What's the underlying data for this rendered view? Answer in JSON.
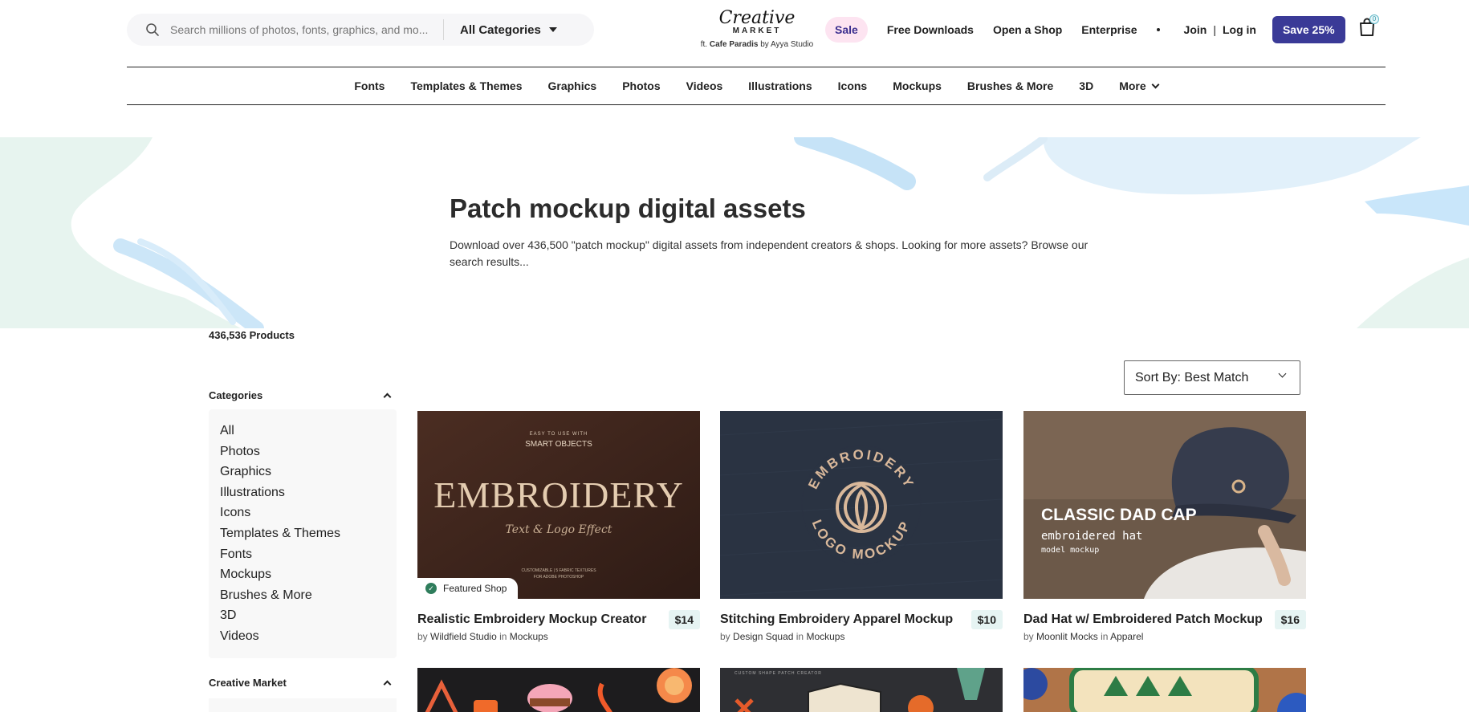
{
  "header": {
    "search_placeholder": "Search millions of photos, fonts, graphics, and mo...",
    "category_select": "All Categories",
    "logo_top": "Creative",
    "logo_bottom": "MARKET",
    "logo_featuring_prefix": "ft.",
    "logo_featuring_name": "Cafe Paradis",
    "logo_featuring_by": "by Ayya Studio",
    "sale": "Sale",
    "free_downloads": "Free Downloads",
    "open_shop": "Open a Shop",
    "enterprise": "Enterprise",
    "join": "Join",
    "separator": "|",
    "login": "Log in",
    "save_cta": "Save 25%",
    "cart_count": "0"
  },
  "category_bar": [
    "Fonts",
    "Templates & Themes",
    "Graphics",
    "Photos",
    "Videos",
    "Illustrations",
    "Icons",
    "Mockups",
    "Brushes & More",
    "3D",
    "More"
  ],
  "hero": {
    "title": "Patch mockup digital assets",
    "description": "Download over 436,500 \"patch mockup\" digital assets from independent creators & shops. Looking for more assets? Browse our search results..."
  },
  "product_count": "436,536 Products",
  "sidebar": {
    "categories_heading": "Categories",
    "categories": [
      "All",
      "Photos",
      "Graphics",
      "Illustrations",
      "Icons",
      "Templates & Themes",
      "Fonts",
      "Mockups",
      "Brushes & More",
      "3D",
      "Videos"
    ],
    "creative_market_heading": "Creative Market"
  },
  "sort": "Sort By: Best Match",
  "products": [
    {
      "title": "Realistic Embroidery Mockup Creator",
      "price": "$14",
      "by": "by",
      "author": "Wildfield Studio",
      "in": "in",
      "category": "Mockups",
      "badge": "Featured Shop",
      "img_top": "EASY TO USE WITH",
      "img_sub": "SMART OBJECTS",
      "img_main": "EMBROIDERY",
      "img_script": "Text & Logo Effect",
      "img_foot1": "CUSTOMIZABLE | 5 FABRIC TEXTURES",
      "img_foot2": "FOR ADOBE PHOTOSHOP"
    },
    {
      "title": "Stitching Embroidery Apparel Mockup",
      "price": "$10",
      "by": "by",
      "author": "Design Squad",
      "in": "in",
      "category": "Mockups",
      "img_ring_top": "EMBROIDERY",
      "img_ring_bottom": "LOGO MOCKUP"
    },
    {
      "title": "Dad Hat w/ Embroidered Patch Mockup",
      "price": "$16",
      "by": "by",
      "author": "Moonlit Mocks",
      "in": "in",
      "category": "Apparel",
      "img_main": "CLASSIC DAD CAP",
      "img_sub": "embroidered hat",
      "img_sub2": "model mockup"
    }
  ],
  "second_row": {
    "patch_text": "CUSTOM SHAPE PATCH CREATOR"
  },
  "colors": {
    "accent": "#3a3a97",
    "sale_bg": "#fde4f1",
    "price_bg": "#e6f4f3"
  }
}
